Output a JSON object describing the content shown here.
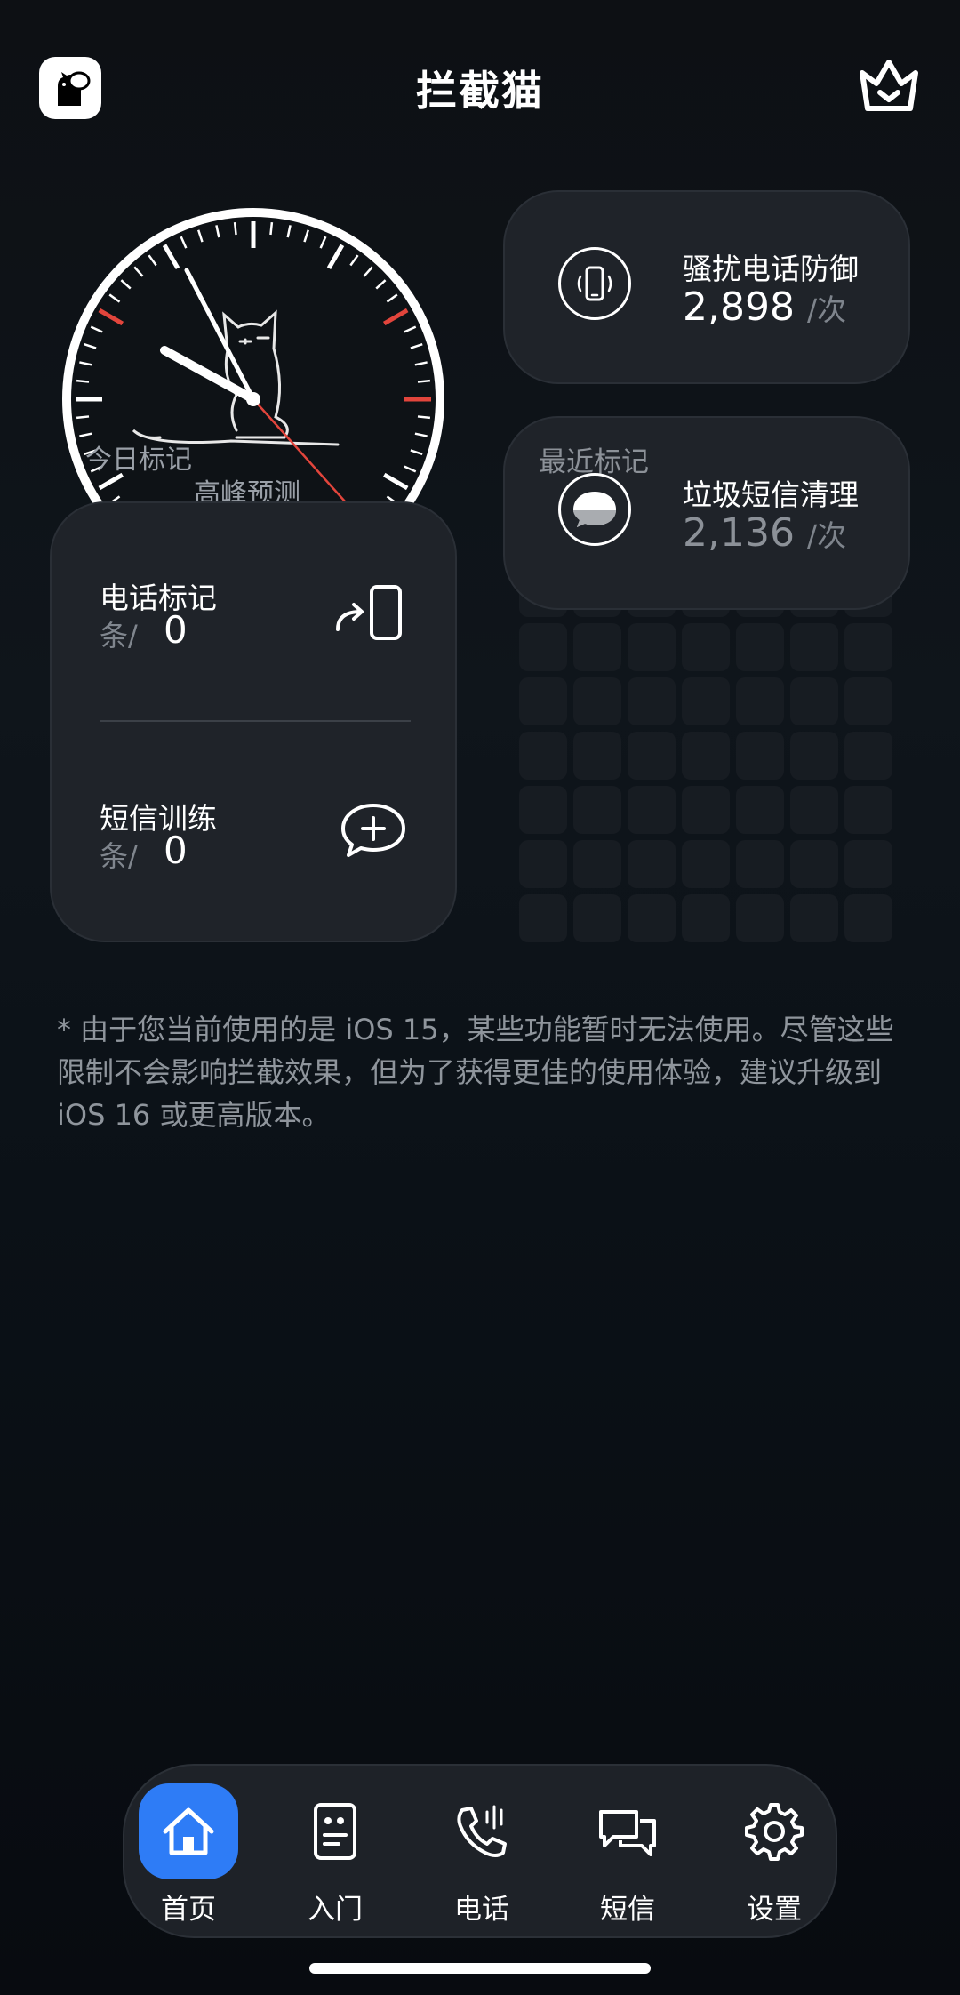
{
  "header": {
    "title": "拦截猫"
  },
  "clock": {
    "today_label": "今日标记",
    "peak_label": "高峰预测"
  },
  "stats": [
    {
      "title": "骚扰电话防御",
      "value": "2,898",
      "unit": "/次"
    },
    {
      "title": "垃圾短信清理",
      "value": "2,136",
      "unit": "/次",
      "corner_label": "最近标记"
    }
  ],
  "marks": [
    {
      "title": "电话标记",
      "unit": "条/",
      "count": "0"
    },
    {
      "title": "短信训练",
      "unit": "条/",
      "count": "0"
    }
  ],
  "notice": "* 由于您当前使用的是 iOS 15，某些功能暂时无法使用。尽管这些限制不会影响拦截效果，但为了获得更佳的使用体验，建议升级到 iOS 16 或更高版本。",
  "tabs": [
    {
      "label": "首页",
      "icon": "home-icon",
      "active": true
    },
    {
      "label": "入门",
      "icon": "guide-icon",
      "active": false
    },
    {
      "label": "电话",
      "icon": "phone-icon",
      "active": false
    },
    {
      "label": "短信",
      "icon": "message-icon",
      "active": false
    },
    {
      "label": "设置",
      "icon": "gear-icon",
      "active": false
    }
  ],
  "colors": {
    "accent": "#2e7cf6",
    "card": "#1f2329",
    "tick_red": "#e2453c"
  }
}
